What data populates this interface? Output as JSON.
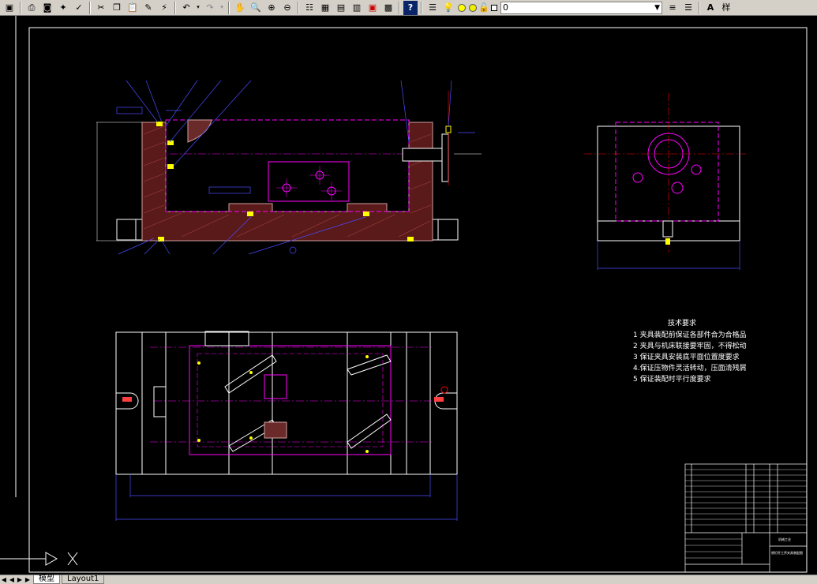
{
  "toolbar": {
    "layer_value": "0",
    "right_label": "样",
    "icons": [
      "save-icon",
      "print-icon",
      "preview-icon",
      "publish-icon",
      "spell-icon",
      "cut-icon",
      "copy-icon",
      "paste-icon",
      "match-icon",
      "brush-icon",
      "undo-icon",
      "redo-icon",
      "pan-icon",
      "zoom-realtime-icon",
      "zoom-window-icon",
      "zoom-previous-icon",
      "properties-icon",
      "design-center-icon",
      "tool-palette-icon",
      "sheet-set-icon",
      "markup-icon",
      "calculator-icon",
      "help-icon",
      "layer-manager-icon",
      "bulb-icon",
      "sun-icon",
      "lock-icon",
      "color-swatch-icon"
    ]
  },
  "drawing": {
    "tech_title": "技术要求",
    "tech_items": [
      "1  夹具装配前保证各部件合为合格品",
      "2  夹具与机床联接要牢固，不得松动",
      "3  保证夹具安装底平面位置度要求",
      "4.保证压物件灵活转动，压面清残屑",
      "5  保证装配时平行度要求"
    ],
    "title_block_label": "机械工业",
    "title_block_name": "销钉杆工序夹具装配图"
  },
  "tabs": {
    "model": "模型",
    "layout1": "Layout1"
  }
}
